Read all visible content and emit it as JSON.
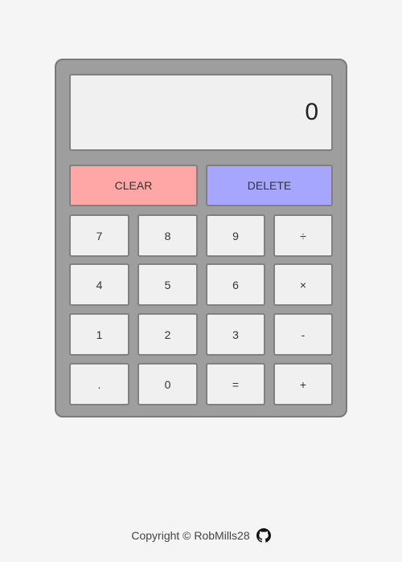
{
  "display": {
    "value": "0"
  },
  "buttons": {
    "clear": "CLEAR",
    "delete": "DELETE",
    "seven": "7",
    "eight": "8",
    "nine": "9",
    "divide": "÷",
    "four": "4",
    "five": "5",
    "six": "6",
    "multiply": "×",
    "one": "1",
    "two": "2",
    "three": "3",
    "subtract": "-",
    "decimal": ".",
    "zero": "0",
    "equals": "=",
    "add": "+"
  },
  "footer": {
    "text": "Copyright © RobMills28",
    "icon": "github-icon"
  },
  "colors": {
    "clear": "#ffa6a6",
    "delete": "#a6a6ff",
    "body": "#9e9e9e",
    "background": "#f5f5f5"
  }
}
